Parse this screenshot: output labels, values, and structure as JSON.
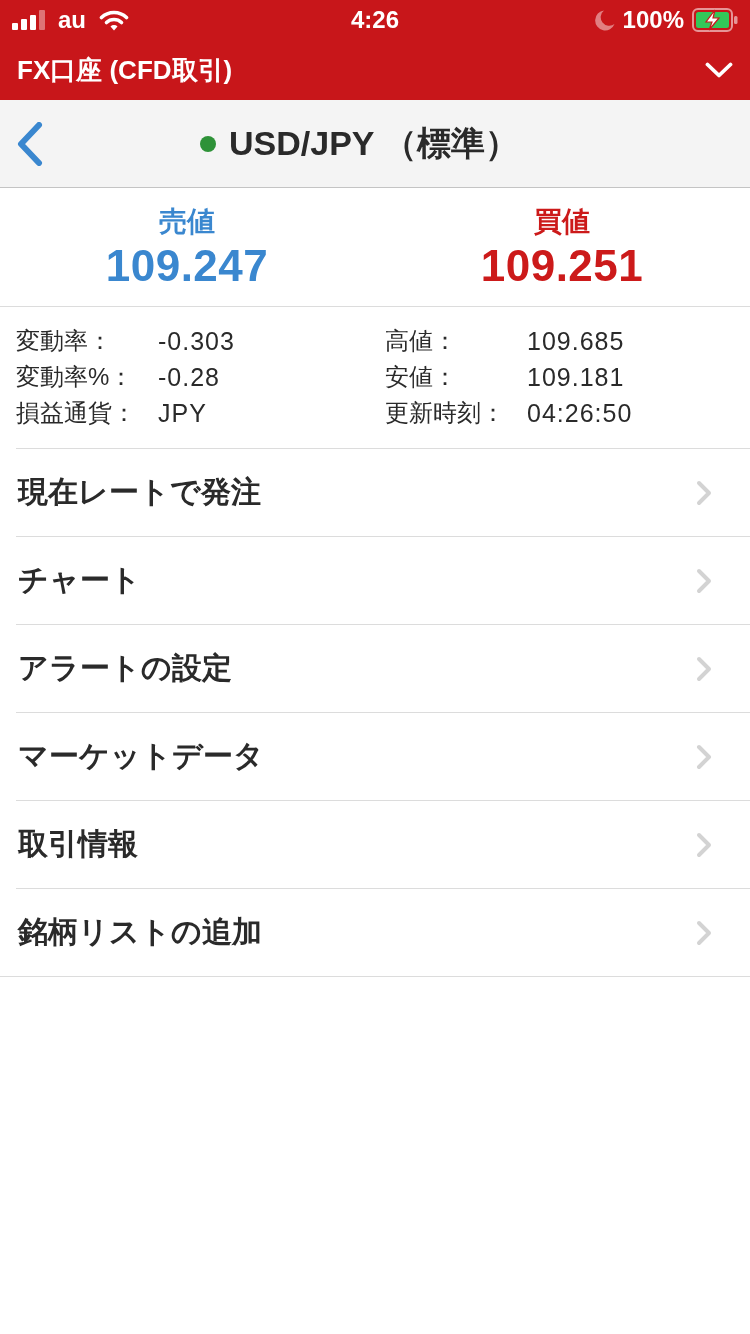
{
  "status_bar": {
    "carrier": "au",
    "time": "4:26",
    "battery": "100%",
    "charging": true
  },
  "header": {
    "title": "FX口座 (CFD取引)"
  },
  "instrument": {
    "title": "USD/JPY （標準）"
  },
  "quotes": [
    {
      "kind": "bid",
      "label": "売値",
      "price": "109.247"
    },
    {
      "kind": "ask",
      "label": "買値",
      "price": "109.251"
    }
  ],
  "stats": [
    {
      "label": "変動率：",
      "value": "-0.303"
    },
    {
      "label": "高値：",
      "value": "109.685"
    },
    {
      "label": "変動率%：",
      "value": "-0.28"
    },
    {
      "label": "安値：",
      "value": "109.181"
    },
    {
      "label": "損益通貨：",
      "value": "JPY"
    },
    {
      "label": "更新時刻：",
      "value": "04:26:50"
    }
  ],
  "menu": [
    {
      "label": "現在レートで発注"
    },
    {
      "label": "チャート"
    },
    {
      "label": "アラートの設定"
    },
    {
      "label": "マーケットデータ"
    },
    {
      "label": "取引情報"
    },
    {
      "label": "銘柄リストの追加"
    }
  ]
}
